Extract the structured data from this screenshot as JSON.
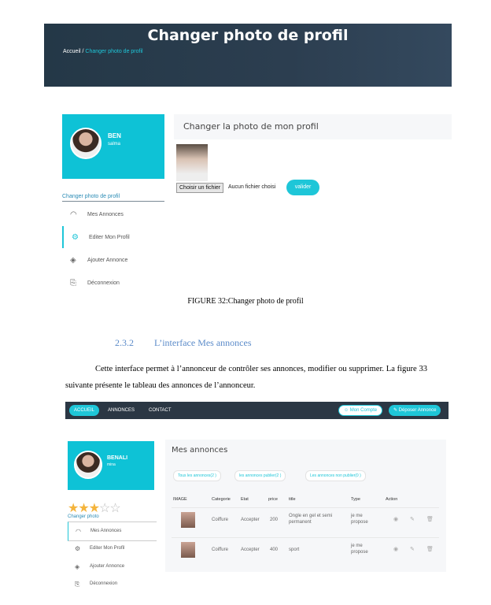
{
  "figure1": {
    "hero_title": "Changer photo de profil",
    "crumb_home": "Accueil /",
    "crumb_current": "Changer photo de profil",
    "profile_first": "BEN",
    "profile_last": "salma",
    "sidebar_heading": "Changer photo de profil",
    "sidebar_items": [
      {
        "label": "Mes Annonces",
        "icon": "dashboard-icon"
      },
      {
        "label": "Editer Mon Profil",
        "icon": "gear-icon"
      },
      {
        "label": "Ajouter Annonce",
        "icon": "layers-icon"
      },
      {
        "label": "Déconnexion",
        "icon": "logout-icon"
      }
    ],
    "panel_title": "Changer la photo de mon profil",
    "file_button": "Choisir un fichier",
    "file_none": "Aucun fichier choisi",
    "submit": "valider",
    "caption": "FIGURE 32:Changer photo de profil"
  },
  "section": {
    "number": "2.3.2",
    "title": "L’interface Mes annonces"
  },
  "paragraph": "Cette interface permet à l’annonceur de contrôler ses annonces, modifier ou supprimer. La figure 33 suivante présente le tableau des annonces de l’annonceur.",
  "figure2": {
    "nav": {
      "accueil": "ACCUEIL",
      "annonces": "ANNONCES",
      "contact": "CONTACT",
      "compte": "Mon Compte",
      "deposer": "Déposer Annonce"
    },
    "profile_first": "BENALI",
    "profile_last": "mina",
    "rating": 3,
    "rating_max": 5,
    "sidebar_heading": "Changer photo",
    "sidebar_items": [
      {
        "label": "Mes Annonces",
        "icon": "dashboard-icon"
      },
      {
        "label": "Editer Mon Profil",
        "icon": "gear-icon"
      },
      {
        "label": "Ajouter Annonce",
        "icon": "layers-icon"
      },
      {
        "label": "Déconnexion",
        "icon": "logout-icon"
      }
    ],
    "panel_title": "Mes annonces",
    "tabs": [
      "Tous les annonces(2 )",
      "les annonces publier(2 )",
      "Les annonces non publier(0 )"
    ],
    "columns": [
      "IMAGE",
      "Categorie",
      "Etat",
      "price",
      "title",
      "Type",
      "Action"
    ],
    "rows": [
      {
        "categorie": "Coiffure",
        "etat": "Accepter",
        "price": "200",
        "title": "Ongle en gel et semi permanent",
        "type": "je me propose"
      },
      {
        "categorie": "Coiffure",
        "etat": "Accepter",
        "price": "400",
        "title": "sport",
        "type": "je me propose"
      }
    ]
  }
}
